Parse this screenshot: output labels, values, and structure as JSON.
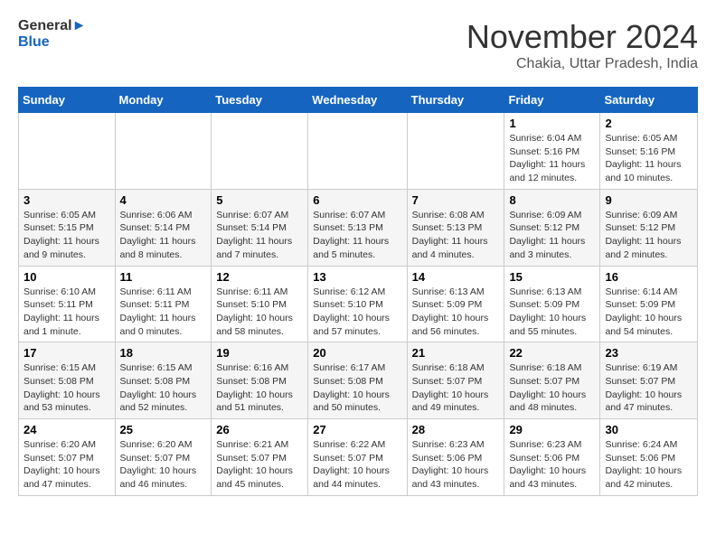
{
  "header": {
    "logo_general": "General",
    "logo_blue": "Blue",
    "month_title": "November 2024",
    "location": "Chakia, Uttar Pradesh, India"
  },
  "calendar": {
    "days_of_week": [
      "Sunday",
      "Monday",
      "Tuesday",
      "Wednesday",
      "Thursday",
      "Friday",
      "Saturday"
    ],
    "weeks": [
      [
        {
          "day": "",
          "info": ""
        },
        {
          "day": "",
          "info": ""
        },
        {
          "day": "",
          "info": ""
        },
        {
          "day": "",
          "info": ""
        },
        {
          "day": "",
          "info": ""
        },
        {
          "day": "1",
          "info": "Sunrise: 6:04 AM\nSunset: 5:16 PM\nDaylight: 11 hours and 12 minutes."
        },
        {
          "day": "2",
          "info": "Sunrise: 6:05 AM\nSunset: 5:16 PM\nDaylight: 11 hours and 10 minutes."
        }
      ],
      [
        {
          "day": "3",
          "info": "Sunrise: 6:05 AM\nSunset: 5:15 PM\nDaylight: 11 hours and 9 minutes."
        },
        {
          "day": "4",
          "info": "Sunrise: 6:06 AM\nSunset: 5:14 PM\nDaylight: 11 hours and 8 minutes."
        },
        {
          "day": "5",
          "info": "Sunrise: 6:07 AM\nSunset: 5:14 PM\nDaylight: 11 hours and 7 minutes."
        },
        {
          "day": "6",
          "info": "Sunrise: 6:07 AM\nSunset: 5:13 PM\nDaylight: 11 hours and 5 minutes."
        },
        {
          "day": "7",
          "info": "Sunrise: 6:08 AM\nSunset: 5:13 PM\nDaylight: 11 hours and 4 minutes."
        },
        {
          "day": "8",
          "info": "Sunrise: 6:09 AM\nSunset: 5:12 PM\nDaylight: 11 hours and 3 minutes."
        },
        {
          "day": "9",
          "info": "Sunrise: 6:09 AM\nSunset: 5:12 PM\nDaylight: 11 hours and 2 minutes."
        }
      ],
      [
        {
          "day": "10",
          "info": "Sunrise: 6:10 AM\nSunset: 5:11 PM\nDaylight: 11 hours and 1 minute."
        },
        {
          "day": "11",
          "info": "Sunrise: 6:11 AM\nSunset: 5:11 PM\nDaylight: 11 hours and 0 minutes."
        },
        {
          "day": "12",
          "info": "Sunrise: 6:11 AM\nSunset: 5:10 PM\nDaylight: 10 hours and 58 minutes."
        },
        {
          "day": "13",
          "info": "Sunrise: 6:12 AM\nSunset: 5:10 PM\nDaylight: 10 hours and 57 minutes."
        },
        {
          "day": "14",
          "info": "Sunrise: 6:13 AM\nSunset: 5:09 PM\nDaylight: 10 hours and 56 minutes."
        },
        {
          "day": "15",
          "info": "Sunrise: 6:13 AM\nSunset: 5:09 PM\nDaylight: 10 hours and 55 minutes."
        },
        {
          "day": "16",
          "info": "Sunrise: 6:14 AM\nSunset: 5:09 PM\nDaylight: 10 hours and 54 minutes."
        }
      ],
      [
        {
          "day": "17",
          "info": "Sunrise: 6:15 AM\nSunset: 5:08 PM\nDaylight: 10 hours and 53 minutes."
        },
        {
          "day": "18",
          "info": "Sunrise: 6:15 AM\nSunset: 5:08 PM\nDaylight: 10 hours and 52 minutes."
        },
        {
          "day": "19",
          "info": "Sunrise: 6:16 AM\nSunset: 5:08 PM\nDaylight: 10 hours and 51 minutes."
        },
        {
          "day": "20",
          "info": "Sunrise: 6:17 AM\nSunset: 5:08 PM\nDaylight: 10 hours and 50 minutes."
        },
        {
          "day": "21",
          "info": "Sunrise: 6:18 AM\nSunset: 5:07 PM\nDaylight: 10 hours and 49 minutes."
        },
        {
          "day": "22",
          "info": "Sunrise: 6:18 AM\nSunset: 5:07 PM\nDaylight: 10 hours and 48 minutes."
        },
        {
          "day": "23",
          "info": "Sunrise: 6:19 AM\nSunset: 5:07 PM\nDaylight: 10 hours and 47 minutes."
        }
      ],
      [
        {
          "day": "24",
          "info": "Sunrise: 6:20 AM\nSunset: 5:07 PM\nDaylight: 10 hours and 47 minutes."
        },
        {
          "day": "25",
          "info": "Sunrise: 6:20 AM\nSunset: 5:07 PM\nDaylight: 10 hours and 46 minutes."
        },
        {
          "day": "26",
          "info": "Sunrise: 6:21 AM\nSunset: 5:07 PM\nDaylight: 10 hours and 45 minutes."
        },
        {
          "day": "27",
          "info": "Sunrise: 6:22 AM\nSunset: 5:07 PM\nDaylight: 10 hours and 44 minutes."
        },
        {
          "day": "28",
          "info": "Sunrise: 6:23 AM\nSunset: 5:06 PM\nDaylight: 10 hours and 43 minutes."
        },
        {
          "day": "29",
          "info": "Sunrise: 6:23 AM\nSunset: 5:06 PM\nDaylight: 10 hours and 43 minutes."
        },
        {
          "day": "30",
          "info": "Sunrise: 6:24 AM\nSunset: 5:06 PM\nDaylight: 10 hours and 42 minutes."
        }
      ]
    ]
  }
}
